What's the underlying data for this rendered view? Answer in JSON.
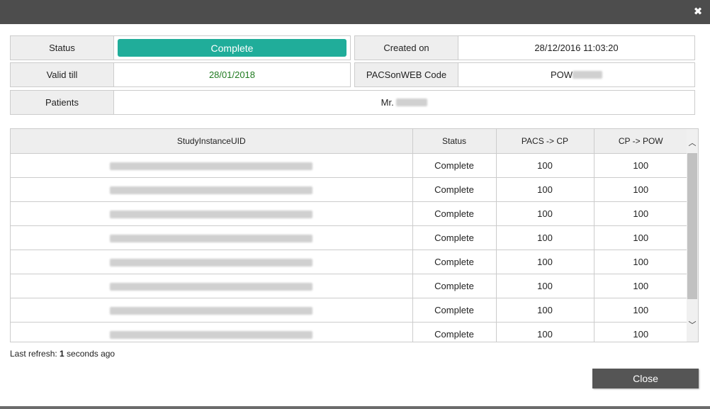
{
  "colors": {
    "titlebar": "#4d4d4d",
    "status_pill": "#20ad9a",
    "valid_green": "#1f7a1f",
    "close_button": "#555555"
  },
  "header": {
    "close_icon": "close-icon"
  },
  "info": {
    "status_label": "Status",
    "status_value": "Complete",
    "created_label": "Created on",
    "created_value": "28/12/2016 11:03:20",
    "valid_label": "Valid till",
    "valid_value": "28/01/2018",
    "code_label": "PACSonWEB Code",
    "code_prefix": "POW",
    "patients_label": "Patients",
    "patients_prefix": "Mr."
  },
  "table": {
    "headers": [
      "StudyInstanceUID",
      "Status",
      "PACS -> CP",
      "CP -> POW"
    ],
    "rows": [
      {
        "status": "Complete",
        "pacs_cp": "100",
        "cp_pow": "100"
      },
      {
        "status": "Complete",
        "pacs_cp": "100",
        "cp_pow": "100"
      },
      {
        "status": "Complete",
        "pacs_cp": "100",
        "cp_pow": "100"
      },
      {
        "status": "Complete",
        "pacs_cp": "100",
        "cp_pow": "100"
      },
      {
        "status": "Complete",
        "pacs_cp": "100",
        "cp_pow": "100"
      },
      {
        "status": "Complete",
        "pacs_cp": "100",
        "cp_pow": "100"
      },
      {
        "status": "Complete",
        "pacs_cp": "100",
        "cp_pow": "100"
      },
      {
        "status": "Complete",
        "pacs_cp": "100",
        "cp_pow": "100"
      }
    ]
  },
  "footer": {
    "refresh_prefix": "Last refresh: ",
    "refresh_count": "1",
    "refresh_suffix": " seconds ago",
    "close_label": "Close"
  }
}
